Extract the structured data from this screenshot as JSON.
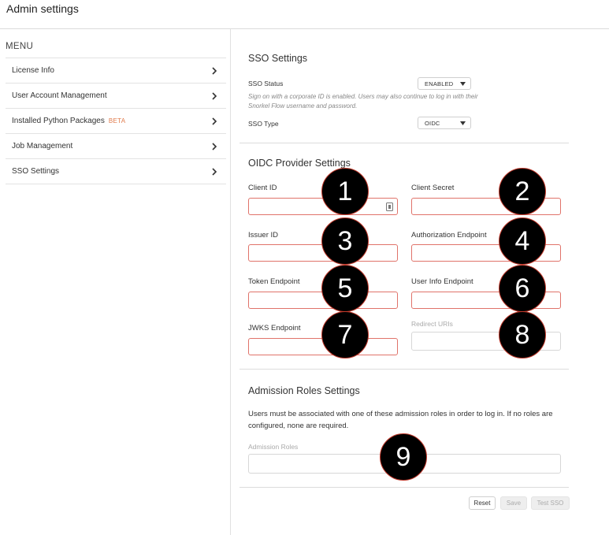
{
  "app": {
    "title": "Admin settings"
  },
  "sidebar": {
    "menu_header": "MENU",
    "items": [
      {
        "label": "License Info"
      },
      {
        "label": "User Account Management"
      },
      {
        "label": "Installed Python Packages",
        "badge": "BETA"
      },
      {
        "label": "Job Management"
      },
      {
        "label": "SSO Settings"
      }
    ]
  },
  "sso": {
    "heading": "SSO Settings",
    "status_label": "SSO Status",
    "status_value": "ENABLED",
    "help_text": "Sign on with a corporate ID is enabled. Users may also continue to log in with their Snorkel Flow username and password.",
    "type_label": "SSO Type",
    "type_value": "OIDC"
  },
  "oidc": {
    "heading": "OIDC Provider Settings",
    "fields": {
      "client_id": {
        "label": "Client ID",
        "value": ""
      },
      "client_secret": {
        "label": "Client Secret",
        "value": ""
      },
      "issuer_id": {
        "label": "Issuer ID",
        "value": ""
      },
      "authorization_endpoint": {
        "label": "Authorization Endpoint",
        "value": ""
      },
      "token_endpoint": {
        "label": "Token Endpoint",
        "value": ""
      },
      "user_info_endpoint": {
        "label": "User Info Endpoint",
        "value": ""
      },
      "jwks_endpoint": {
        "label": "JWKS Endpoint",
        "value": ""
      },
      "redirect_uris": {
        "label": "Redirect URIs",
        "value": ""
      }
    }
  },
  "roles": {
    "heading": "Admission Roles Settings",
    "help_text": "Users must be associated with one of these admission roles in order to log in. If no roles are configured, none are required.",
    "field_label": "Admission Roles",
    "value": ""
  },
  "actions": {
    "reset": "Reset",
    "save": "Save",
    "test": "Test SSO"
  },
  "markers": [
    "1",
    "2",
    "3",
    "4",
    "5",
    "6",
    "7",
    "8",
    "9"
  ],
  "colors": {
    "error_border": "#e0736a",
    "beta_badge": "#e07a4a",
    "marker_fill": "#000000"
  },
  "icons": {
    "menu_chevron": "chevron-right-icon",
    "select_arrow": "caret-down-icon",
    "client_id_adornment": "key-icon"
  }
}
